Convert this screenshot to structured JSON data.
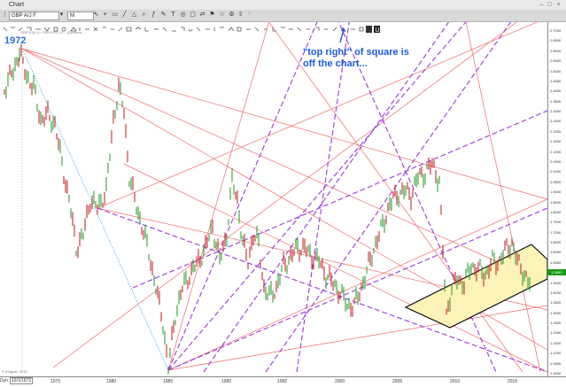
{
  "window": {
    "title": "Chart",
    "buttons": [
      "–",
      "□",
      "×"
    ]
  },
  "toolbar": {
    "symbol": "GBP A/J F",
    "interval": "M",
    "icons": [
      "dropdown-icon",
      "cursor-icon",
      "crosshair-icon",
      "chart-type-icon",
      "line-icon",
      "indicator-icon",
      "zoom-icon",
      "study-icon",
      "draw-icon",
      "text-icon",
      "shape-icon",
      "arrow-icon",
      "flag-icon",
      "star-icon",
      "globe-icon",
      "gear-icon",
      "refresh-icon",
      "share-icon",
      "twitter-icon"
    ]
  },
  "legend": "GBP/USD A / GBP/USD 10 ...(Dynamic ...",
  "label_year": "1972",
  "annotation": {
    "line1": "\"top right\" of square is",
    "line2": "off the chart..."
  },
  "y_axis": {
    "ticks": [
      "2.7000",
      "2.6500",
      "2.6000",
      "2.5500",
      "2.5000",
      "2.4500",
      "2.4000",
      "2.3500",
      "2.3000",
      "2.2500",
      "2.2000",
      "2.1500",
      "2.1000",
      "2.0500",
      "2.0000",
      "1.9500",
      "1.9000",
      "1.8500",
      "1.8000",
      "1.7500",
      "1.7000",
      "1.6500",
      "1.6000",
      "1.5500",
      "1.5000",
      "1.4500",
      "1.4000",
      "1.3500",
      "1.3000",
      "1.2500",
      "1.2000",
      "1.1500",
      "1.1000",
      "1.0500",
      "1.0000"
    ],
    "last_price": "1.5960"
  },
  "x_axis": {
    "ticks": [
      "1975",
      "1980",
      "1985",
      "1990",
      "1995",
      "2000",
      "2005",
      "2010",
      "2015"
    ]
  },
  "bottom_bar": {
    "period": "Dyn",
    "range": "10/1/1972"
  },
  "copyright": "© eSignal, 2015",
  "colors": {
    "fan_red": "#f06a6a",
    "fan_purple": "#9a3ad8",
    "box_fill": "#fcf3b8",
    "up_candle": "#3a9a3a",
    "down_candle": "#c03030",
    "label_blue": "#1f5bd8",
    "trend_blue": "#4aa0e8"
  }
}
